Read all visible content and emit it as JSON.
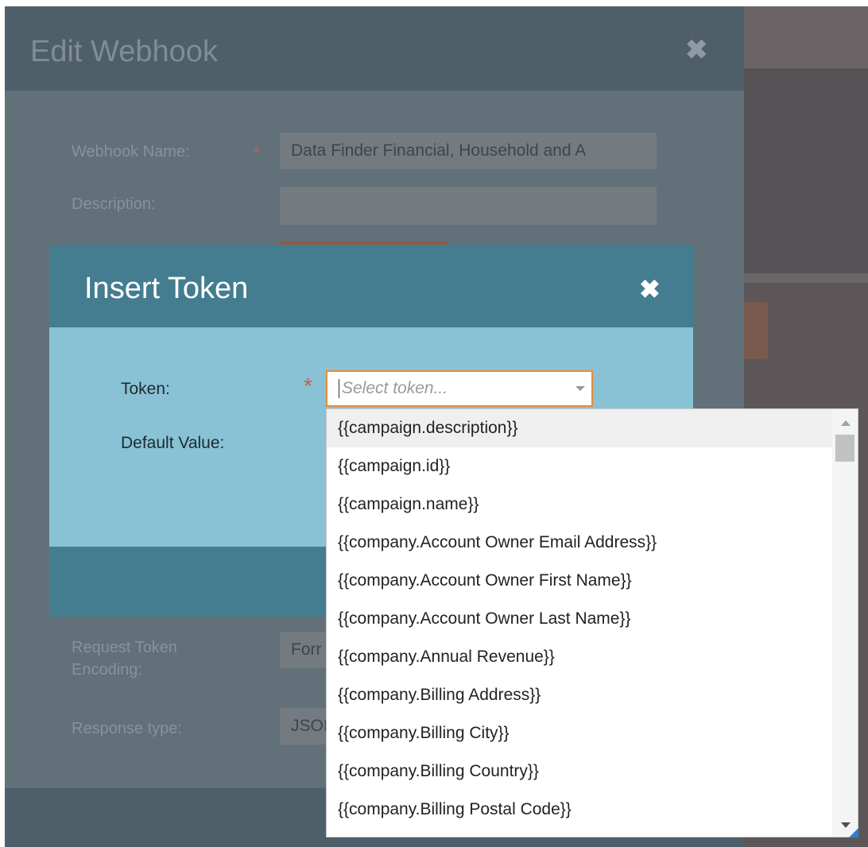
{
  "outer_dialog": {
    "title": "Edit Webhook",
    "close_glyph": "✖",
    "fields": {
      "webhook_name_label": "Webhook Name:",
      "webhook_name_value": "Data Finder Financial, Household and A",
      "description_label": "Description:",
      "description_value": "",
      "request_token_encoding_label_line1": "Request Token",
      "request_token_encoding_label_line2": "Encoding:",
      "request_token_encoding_value": "Forr",
      "response_type_label": "Response type:",
      "response_type_value": "JSOI"
    },
    "required_star": "*"
  },
  "modal": {
    "title": "Insert Token",
    "close_glyph": "✖",
    "token_label": "Token:",
    "default_value_label": "Default Value:",
    "required_star": "*",
    "token_select": {
      "placeholder": "Select token...",
      "chevron_icon": "chevron-down-icon"
    }
  },
  "dropdown": {
    "highlighted_index": 0,
    "items": [
      "{{campaign.description}}",
      "{{campaign.id}}",
      "{{campaign.name}}",
      "{{company.Account Owner Email Address}}",
      "{{company.Account Owner First Name}}",
      "{{company.Account Owner Last Name}}",
      "{{company.Annual Revenue}}",
      "{{company.Billing Address}}",
      "{{company.Billing City}}",
      "{{company.Billing Country}}",
      "{{company.Billing Postal Code}}"
    ]
  },
  "colors": {
    "modal_header": "#447d90",
    "modal_body": "#88c2d4",
    "select_focus_border": "#e88b3a",
    "required_star": "#d9534f"
  }
}
